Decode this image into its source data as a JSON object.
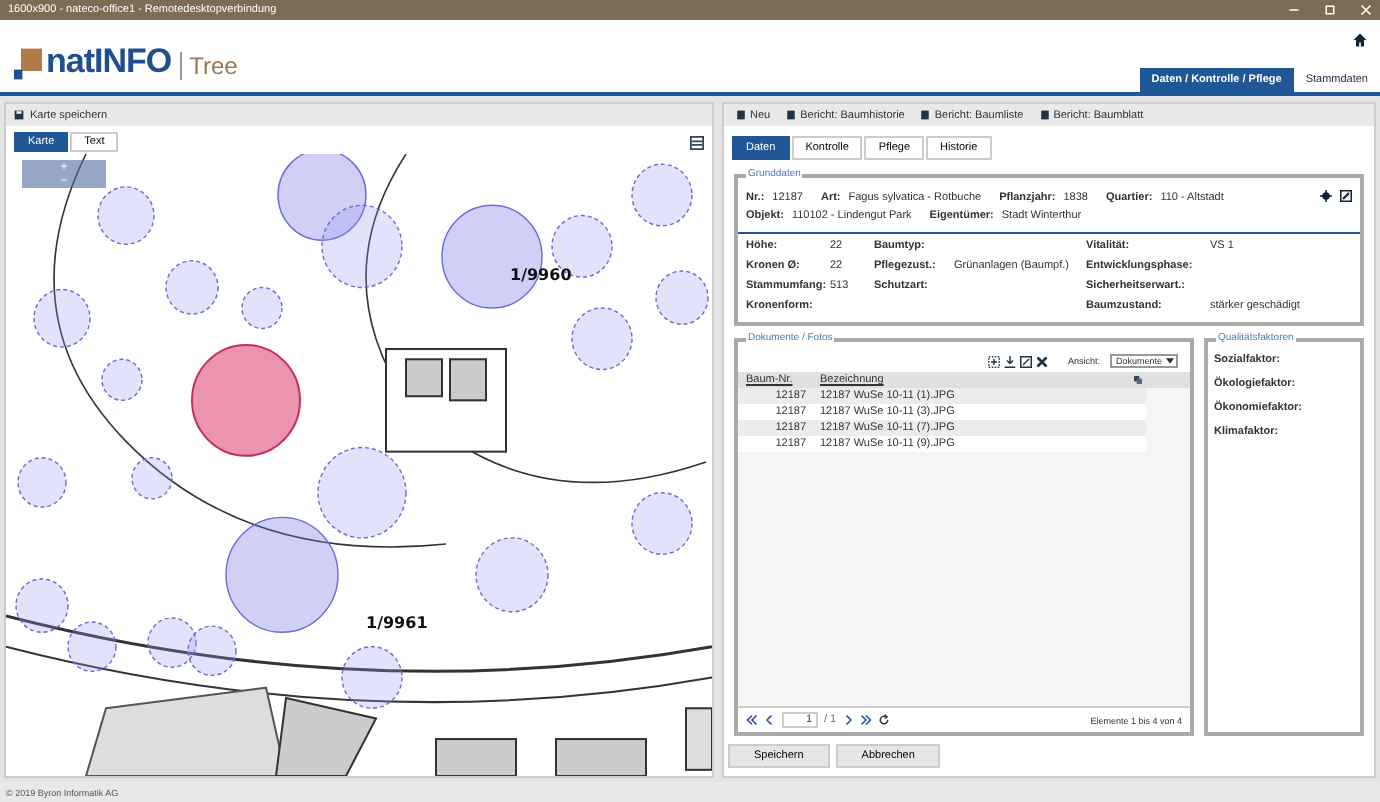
{
  "window": {
    "title": "1600x900 - nateco-office1 - Remotedesktopverbindung"
  },
  "app": {
    "logo": "natINFO",
    "product": "Tree"
  },
  "nav_tabs": [
    {
      "label": "Daten / Kontrolle / Pflege",
      "selected": true
    },
    {
      "label": "Stammdaten",
      "selected": false
    }
  ],
  "map_panel": {
    "save_label": "Karte speichern",
    "tabs": [
      {
        "label": "Karte",
        "selected": true
      },
      {
        "label": "Text",
        "selected": false
      }
    ],
    "zoom": [
      "+",
      "−"
    ],
    "labels": [
      "1/9960",
      "1/9961"
    ]
  },
  "toolbar": [
    "Neu",
    "Bericht: Baumhistorie",
    "Bericht: Baumliste",
    "Bericht: Baumblatt"
  ],
  "detail_tabs": [
    {
      "label": "Daten",
      "selected": true
    },
    {
      "label": "Kontrolle",
      "selected": false
    },
    {
      "label": "Pflege",
      "selected": false
    },
    {
      "label": "Historie",
      "selected": false
    }
  ],
  "grunddaten": {
    "legend": "Grunddaten",
    "header_rows": [
      [
        {
          "label": "Nr.:",
          "value": "12187"
        },
        {
          "label": "Art:",
          "value": "Fagus sylvatica - Rotbuche"
        },
        {
          "label": "Pflanzjahr:",
          "value": "1838"
        },
        {
          "label": "Quartier:",
          "value": "110 - Altstadt"
        }
      ],
      [
        {
          "label": "Objekt:",
          "value": "110102 - Lindengut Park"
        },
        {
          "label": "Eigentümer:",
          "value": "Stadt Winterthur"
        }
      ]
    ],
    "rows": [
      {
        "left": {
          "label": "Höhe:",
          "value": "22"
        },
        "middle": {
          "label": "Baumtyp:"
        },
        "right": {
          "label": "Vitalität:",
          "value": "VS 1"
        }
      },
      {
        "left": {
          "label": "Kronen Ø:",
          "value": "22"
        },
        "middle": {
          "label": "Pflegezust.:",
          "value": "Grünanlagen (Baumpf.)"
        },
        "right": {
          "label": "Entwicklungsphase:"
        }
      },
      {
        "left": {
          "label": "Stammumfang:",
          "value": "513"
        },
        "middle": {
          "label": "Schutzart:"
        },
        "right": {
          "label": "Sicherheitserwart.:"
        }
      },
      {
        "left": {
          "label": "Kronenform:"
        },
        "right": {
          "label": "Baumzustand:",
          "value": "stärker geschädigt"
        }
      }
    ]
  },
  "documents": {
    "legend": "Dokumente / Fotos",
    "view_label": "Ansicht:",
    "view_value": "Dokumente",
    "columns": [
      "Baum-Nr.",
      "Bezeichnung"
    ],
    "rows": [
      {
        "nr": "12187",
        "name": "12187 WuSe 10-11 (1).JPG"
      },
      {
        "nr": "12187",
        "name": "12187 WuSe 10-11 (3).JPG"
      },
      {
        "nr": "12187",
        "name": "12187 WuSe 10-11 (7).JPG"
      },
      {
        "nr": "12187",
        "name": "12187 WuSe 10-11 (9).JPG"
      }
    ],
    "page": "1",
    "page_total": "/ 1",
    "summary": "Elemente 1 bis 4 von 4"
  },
  "quality": {
    "legend": "Qualitätsfaktoren",
    "fields": [
      "Sozialfaktor:",
      "Ökologiefaktor:",
      "Ökonomiefaktor:",
      "Klimafaktor:"
    ]
  },
  "buttons": [
    "Speichern",
    "Abbrechen"
  ],
  "status_bar": "© 2019 Byron Informatik AG"
}
